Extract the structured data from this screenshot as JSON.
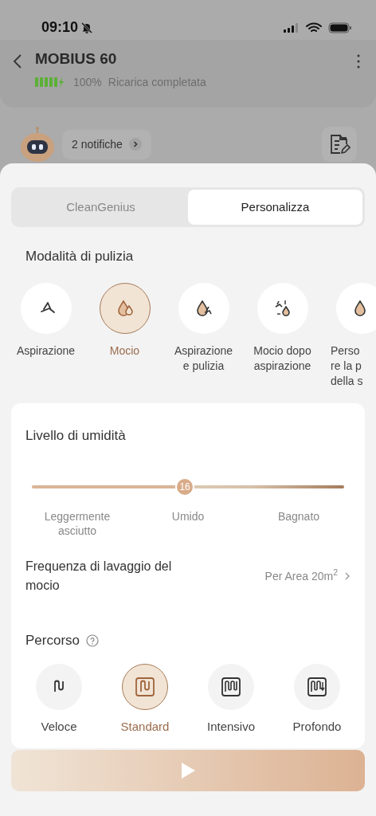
{
  "status_bar": {
    "time": "09:10"
  },
  "header": {
    "title": "MOBIUS 60",
    "battery_percent": "100%",
    "battery_status": "Ricarica completata"
  },
  "notification": {
    "label": "2 notifiche"
  },
  "tabs": [
    {
      "label": "CleanGenius",
      "selected": false
    },
    {
      "label": "Personalizza",
      "selected": true
    }
  ],
  "cleaning_mode": {
    "title": "Modalità di pulizia",
    "items": [
      {
        "kind": "vacuum",
        "lines": [
          "Aspirazione"
        ],
        "selected": false
      },
      {
        "kind": "mop",
        "lines": [
          "Mocio"
        ],
        "selected": true
      },
      {
        "kind": "vacuum_mop",
        "lines": [
          "Aspirazione",
          "e pulizia"
        ],
        "selected": false
      },
      {
        "kind": "mop_after",
        "lines": [
          "Mocio dopo",
          "aspirazione"
        ],
        "selected": false
      },
      {
        "kind": "custom",
        "lines": [
          "Perso",
          "re la p",
          "della s"
        ],
        "selected": false
      }
    ]
  },
  "humidity": {
    "title": "Livello di umidità",
    "value": "16",
    "level": 0.49,
    "labels": [
      [
        "Leggermente",
        "asciutto"
      ],
      [
        "Umido"
      ],
      [
        "Bagnato"
      ]
    ]
  },
  "wash_frequency": {
    "label": "Frequenza di lavaggio del mocio",
    "value": "Per Area 20m$^{2}$"
  },
  "route": {
    "title": "Percorso",
    "items": [
      {
        "kind": "quick",
        "label": "Veloce",
        "selected": false
      },
      {
        "kind": "standard",
        "label": "Standard",
        "selected": true
      },
      {
        "kind": "intensive",
        "label": "Intensivo",
        "selected": false
      },
      {
        "kind": "deep",
        "label": "Profondo",
        "selected": false
      }
    ]
  }
}
